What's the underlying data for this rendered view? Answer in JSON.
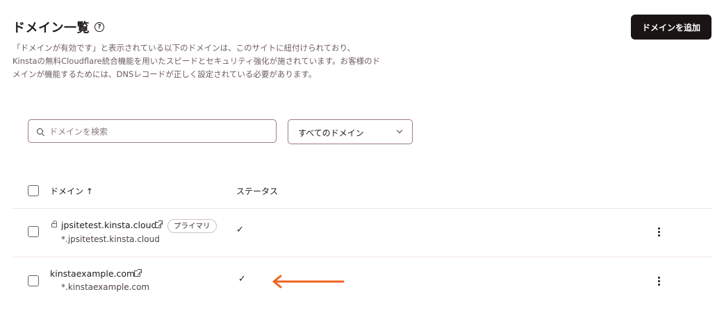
{
  "header": {
    "title": "ドメイン一覧",
    "help_icon": "?",
    "add_button_label": "ドメインを追加"
  },
  "description": {
    "lines": [
      "「ドメインが有効です」と表示されている以下のドメインは、このサイトに紐付けられており、",
      "Kinstaの無料Cloudflare統合機能を用いたスピードとセキュリティ強化が施されています。お客様のド",
      "メインが機能するためには、DNSレコードが正しく設定されている必要があります。"
    ]
  },
  "search": {
    "placeholder": "ドメインを検索",
    "value": ""
  },
  "filter": {
    "selected": "すべてのドメイン"
  },
  "table": {
    "headers": {
      "domain": "ドメイン ↑",
      "status": "ステータス"
    },
    "rows": [
      {
        "domain": "jpsitetest.kinsta.cloud",
        "subdomain": "*.jpsitetest.kinsta.cloud",
        "badge": "プライマリ",
        "status": "✓"
      },
      {
        "domain": "kinstaexample.com",
        "subdomain": "*.kinstaexample.com",
        "status": "✓"
      }
    ]
  },
  "colors": {
    "annotation_arrow": "#f0641e",
    "primary_button": "#1a1414"
  }
}
